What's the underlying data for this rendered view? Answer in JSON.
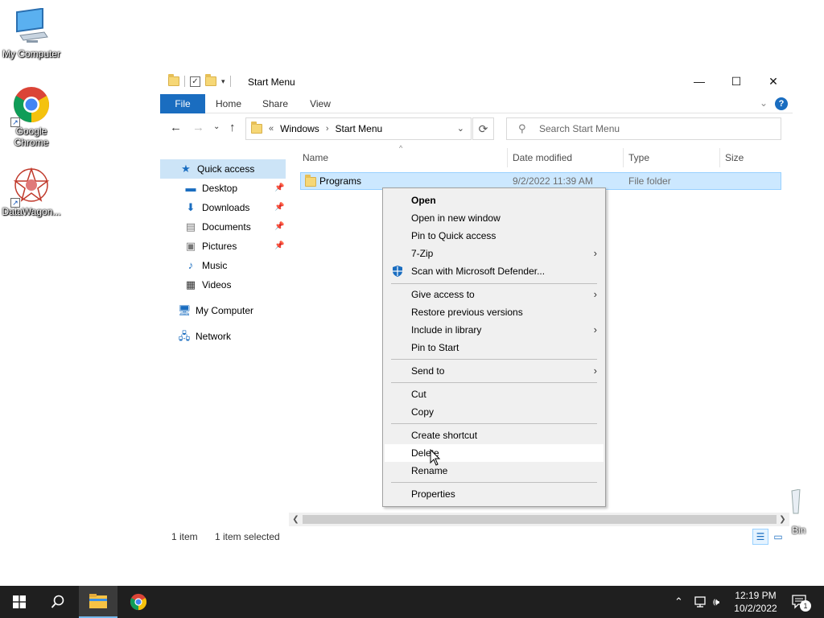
{
  "desktop": {
    "icons": [
      {
        "label": "My Computer"
      },
      {
        "label": "Google Chrome"
      },
      {
        "label": "DataWagon..."
      }
    ],
    "recycle_bin_label": "Bin"
  },
  "window": {
    "title": "Start Menu",
    "ribbon_tabs": [
      "File",
      "Home",
      "Share",
      "View"
    ],
    "address": {
      "overflow": "«",
      "crumbs": [
        "Windows",
        "Start Menu"
      ]
    },
    "search_placeholder": "Search Start Menu",
    "nav_pane": {
      "quick_access": "Quick access",
      "items": [
        "Desktop",
        "Downloads",
        "Documents",
        "Pictures",
        "Music",
        "Videos"
      ],
      "my_computer": "My Computer",
      "network": "Network"
    },
    "columns": [
      "Name",
      "Date modified",
      "Type",
      "Size"
    ],
    "rows": [
      {
        "name": "Programs",
        "date": "9/2/2022 11:39 AM",
        "type": "File folder",
        "size": ""
      }
    ],
    "status": {
      "count": "1 item",
      "selected": "1 item selected"
    }
  },
  "context_menu": {
    "items": [
      {
        "label": "Open",
        "bold": true
      },
      {
        "label": "Open in new window"
      },
      {
        "label": "Pin to Quick access"
      },
      {
        "label": "7-Zip",
        "submenu": true
      },
      {
        "label": "Scan with Microsoft Defender...",
        "icon": "defender-icon"
      },
      {
        "label": "Give access to",
        "submenu": true
      },
      {
        "label": "Restore previous versions"
      },
      {
        "label": "Include in library",
        "submenu": true
      },
      {
        "label": "Pin to Start"
      },
      {
        "label": "Send to",
        "submenu": true
      },
      {
        "label": "Cut"
      },
      {
        "label": "Copy"
      },
      {
        "label": "Create shortcut"
      },
      {
        "label": "Delete",
        "hovered": true
      },
      {
        "label": "Rename"
      },
      {
        "label": "Properties"
      }
    ]
  },
  "taskbar": {
    "time": "12:19 PM",
    "date": "10/2/2022",
    "notification_count": "1"
  },
  "colors": {
    "accent": "#1a6dc0",
    "selection": "#cce8ff",
    "menu_bg": "#f0f0f0",
    "taskbar": "#1f1f1f"
  }
}
